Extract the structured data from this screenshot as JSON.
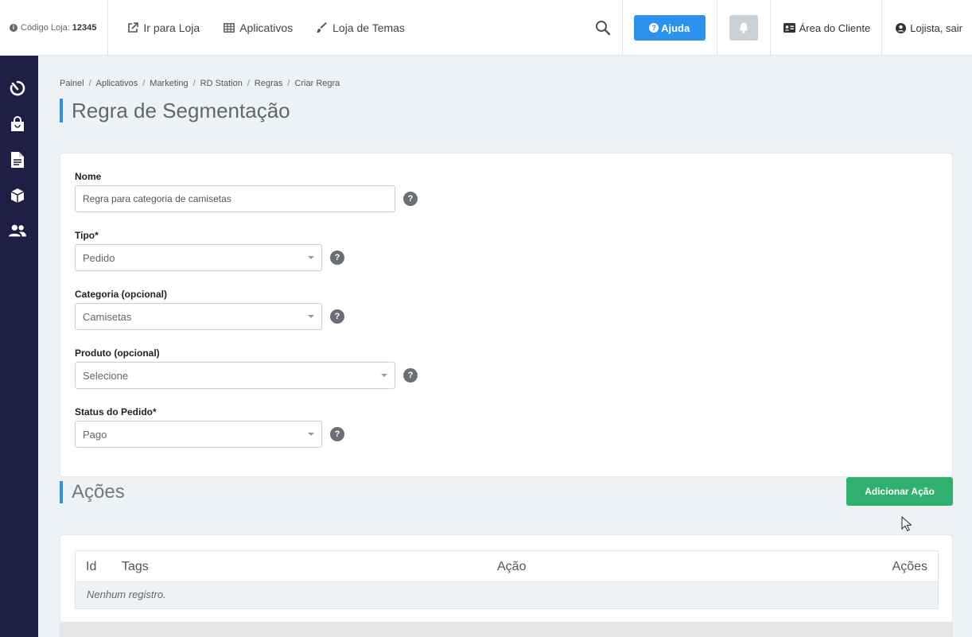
{
  "topbar": {
    "store_code_label": "Código Loja:",
    "store_code_value": "12345",
    "go_to_store": "Ir para Loja",
    "apps": "Aplicativos",
    "theme_store": "Loja de Temas",
    "help": "Ajuda",
    "client_area": "Área do Cliente",
    "user_logout": "Lojista, sair"
  },
  "breadcrumb": [
    "Painel",
    "Aplicativos",
    "Marketing",
    "RD Station",
    "Regras",
    "Criar Regra"
  ],
  "page_title": "Regra de Segmentação",
  "form": {
    "name_label": "Nome",
    "name_value": "Regra para categoria de camisetas",
    "type_label": "Tipo*",
    "type_value": "Pedido",
    "category_label": "Categoria (opcional)",
    "category_value": "Camisetas",
    "product_label": "Produto (opcional)",
    "product_value": "Selecione",
    "status_label": "Status do Pedido*",
    "status_value": "Pago",
    "help_glyph": "?"
  },
  "actions_section": {
    "title": "Ações",
    "add_button": "Adicionar Ação",
    "columns": [
      "Id",
      "Tags",
      "Ação",
      "Ações"
    ],
    "empty_text": "Nenhum registro."
  },
  "colors": {
    "accent": "#2b93ee",
    "sidebar": "#1f1f45",
    "success": "#2fb06f"
  }
}
